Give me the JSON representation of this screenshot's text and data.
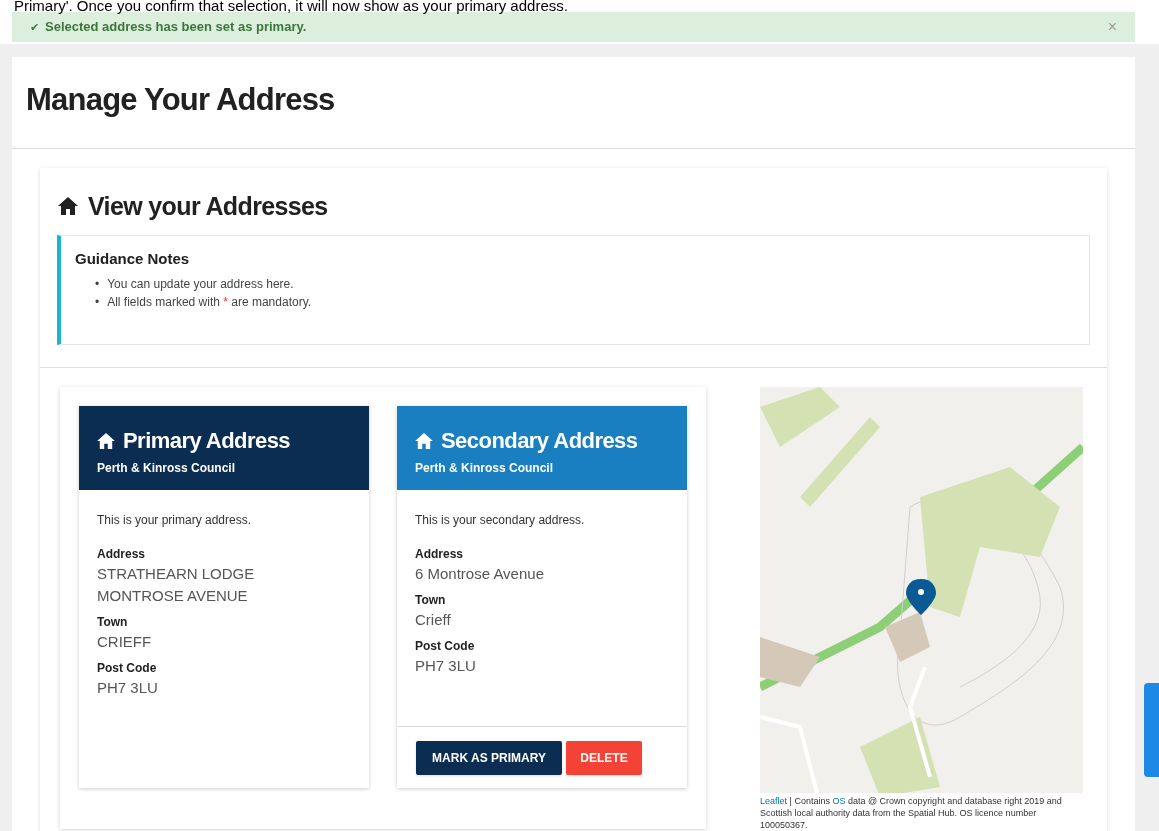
{
  "notice": "Primary'. Once you confirm that selection, it will now show as your primary address.",
  "alert": {
    "icon": "✔",
    "message": "Selected address has been set as primary.",
    "close": "×"
  },
  "page_title": "Manage Your Address",
  "section_title": "View your Addresses",
  "guidance": {
    "title": "Guidance Notes",
    "items": [
      {
        "marker": "•",
        "text": "You can update your address here."
      },
      {
        "marker": "•",
        "text": "All fields marked with",
        "required_mark": "*",
        "text_after": "are mandatory."
      }
    ]
  },
  "addresses": [
    {
      "kind": "primary",
      "title": "Primary Address",
      "council": "Perth & Kinross Council",
      "intro": "This is your primary address.",
      "fields": [
        {
          "label": "Address",
          "value": "STRATHEARN LODGE MONTROSE AVENUE"
        },
        {
          "label": "Town",
          "value": "CRIEFF"
        },
        {
          "label": "Post Code",
          "value": "PH7 3LU"
        }
      ]
    },
    {
      "kind": "secondary",
      "title": "Secondary Address",
      "council": "Perth & Kinross Council",
      "intro": "This is your secondary address.",
      "fields": [
        {
          "label": "Address",
          "value": "6 Montrose Avenue"
        },
        {
          "label": "Town",
          "value": "Crieff"
        },
        {
          "label": "Post Code",
          "value": "PH7 3LU"
        }
      ],
      "buttons": [
        {
          "label": "MARK AS PRIMARY",
          "kind": "primary"
        },
        {
          "label": "DELETE",
          "kind": "danger"
        }
      ]
    }
  ],
  "map": {
    "attribution": [
      {
        "text": "Leaflet",
        "link": true
      },
      {
        "text": "| Contains",
        "link": false
      },
      {
        "text": "OS",
        "link": true
      },
      {
        "text": "data @ Crown copyright and database right 2019 and Scottish local authority data from the Spatial Hub. OS licence number 100050367.",
        "link": false
      }
    ]
  }
}
